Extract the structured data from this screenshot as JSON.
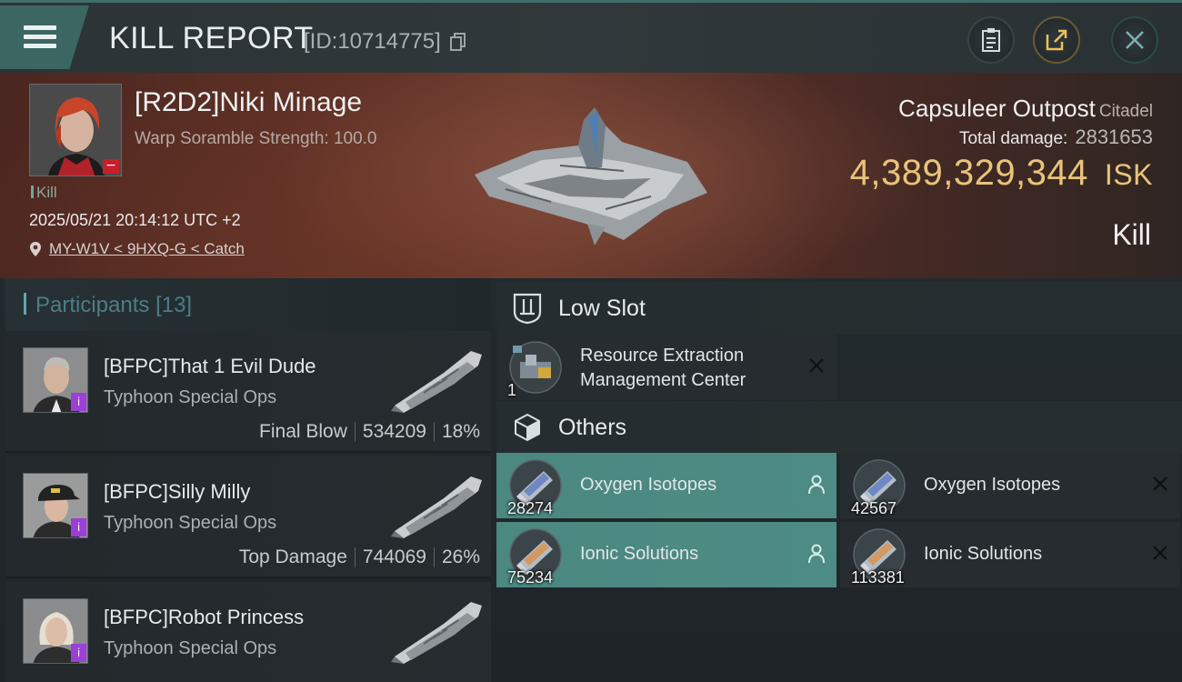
{
  "header": {
    "title": "KILL REPORT",
    "id_text": "[ID:10714775]"
  },
  "victim": {
    "name": "[R2D2]Niki Minage",
    "subtitle": "Warp Soramble Strength: 100.0",
    "tag": "Kill",
    "datetime": "2025/05/21 20:14:12 UTC +2",
    "location": "MY-W1V < 9HXQ-G < Catch"
  },
  "target": {
    "name": "Capsuleer Outpost",
    "class": "Citadel",
    "total_damage_label": "Total damage:",
    "total_damage_value": "2831653",
    "isk_value": "4,389,329,344",
    "isk_unit": "ISK",
    "result": "Kill"
  },
  "participants": {
    "title": "Participants",
    "count": "[13]",
    "items": [
      {
        "name": "[BFPC]That 1 Evil Dude",
        "ship": "Typhoon Special Ops",
        "role": "Final Blow",
        "damage": "534209",
        "percent": "18%"
      },
      {
        "name": "[BFPC]Silly Milly",
        "ship": "Typhoon Special Ops",
        "role": "Top Damage",
        "damage": "744069",
        "percent": "26%"
      },
      {
        "name": "[BFPC]Robot Princess",
        "ship": "Typhoon Special Ops"
      }
    ]
  },
  "low_slot": {
    "title": "Low Slot",
    "items": [
      {
        "name_line1": "Resource Extraction",
        "name_line2": "Management Center",
        "qty": "1"
      }
    ]
  },
  "others": {
    "title": "Others",
    "items": [
      {
        "name": "Oxygen Isotopes",
        "qty": "28274",
        "state": "dropped"
      },
      {
        "name": "Oxygen Isotopes",
        "qty": "42567",
        "state": "destroyed"
      },
      {
        "name": "Ionic Solutions",
        "qty": "75234",
        "state": "dropped"
      },
      {
        "name": "Ionic Solutions",
        "qty": "113381",
        "state": "destroyed"
      }
    ]
  },
  "colors": {
    "accent_teal": "#4a8880",
    "isk_gold": "#e8c47a",
    "banner_red": "#5e3025",
    "badge_purple": "#9b3fd7"
  }
}
